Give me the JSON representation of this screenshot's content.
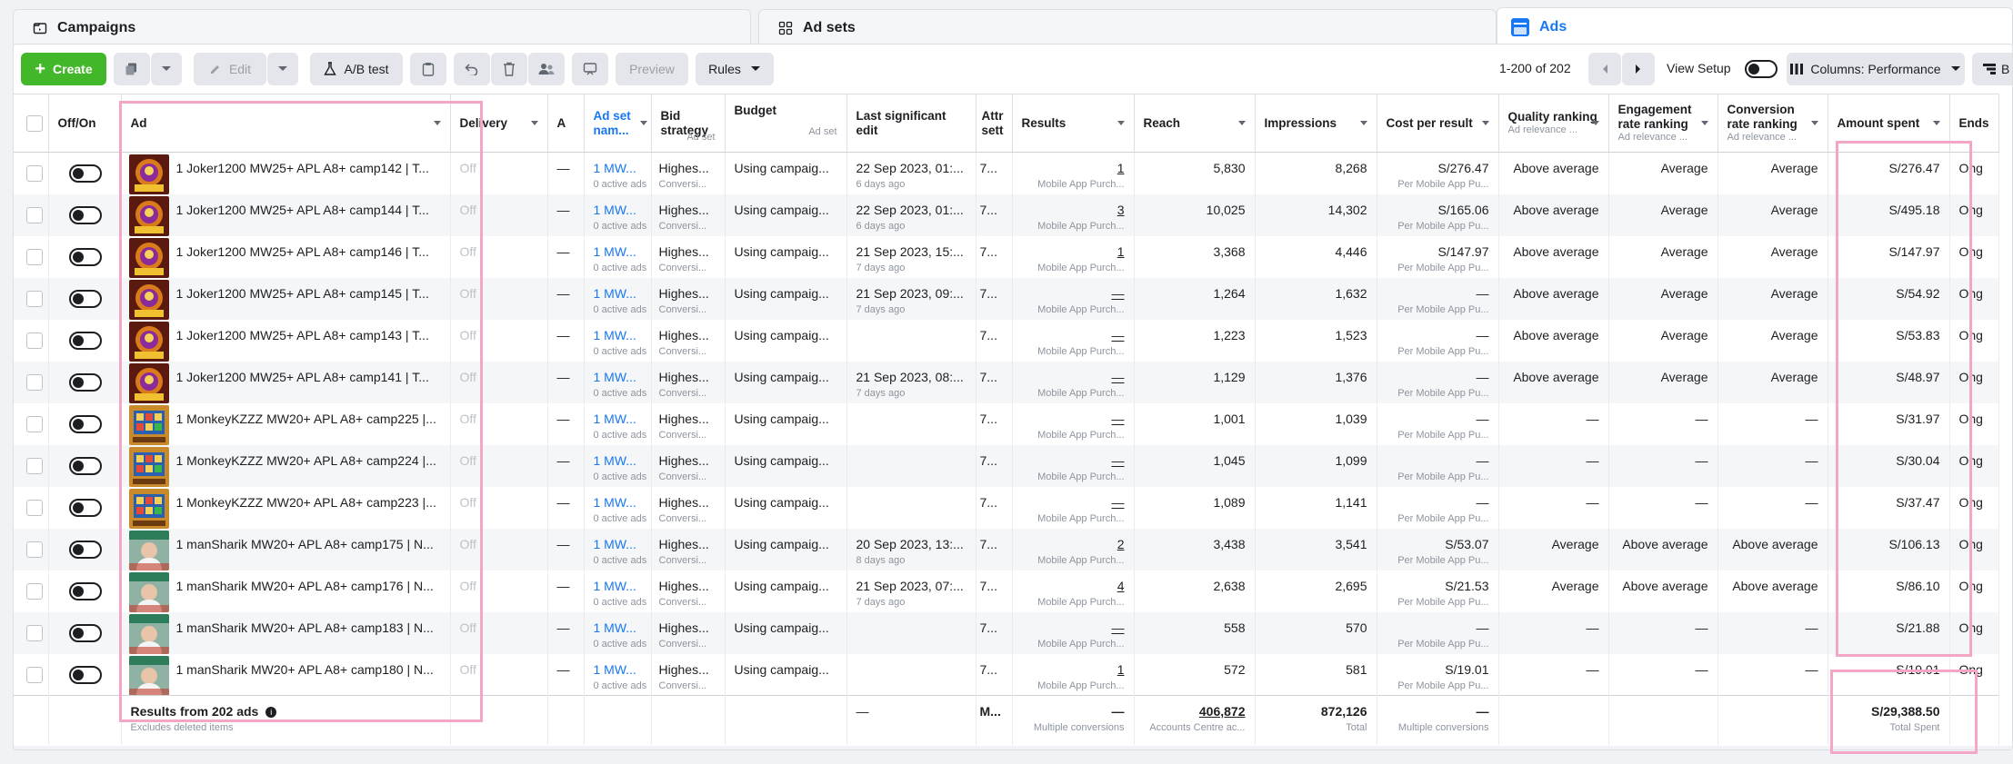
{
  "tabs": [
    {
      "label": "Campaigns",
      "icon": "folder-icon"
    },
    {
      "label": "Ad sets",
      "icon": "grid-icon"
    },
    {
      "label": "Ads",
      "icon": "ads-icon"
    }
  ],
  "toolbar": {
    "create_label": "Create",
    "edit_label": "Edit",
    "ab_test_label": "A/B test",
    "preview_label": "Preview",
    "rules_label": "Rules",
    "pagination": "1-200 of 202",
    "view_setup_label": "View Setup",
    "columns_label": "Columns: Performance",
    "breakdown_label": "B"
  },
  "columns": {
    "offon": "Off/On",
    "ad": "Ad",
    "delivery": "Delivery",
    "a": "A",
    "adset_name": "Ad set nam...",
    "bid_strategy": "Bid strategy",
    "bid_strategy_sub": "Ad set",
    "budget": "Budget",
    "budget_sub": "Ad set",
    "last_edit": "Last significant edit",
    "attr": "Attr sett",
    "results": "Results",
    "reach": "Reach",
    "impressions": "Impressions",
    "cpr": "Cost per result",
    "quality": "Quality ranking",
    "quality_sub": "Ad relevance ...",
    "engagement": "Engagement rate ranking",
    "engagement_sub": "Ad relevance ...",
    "conversion": "Conversion rate ranking",
    "conversion_sub": "Ad relevance ...",
    "amount": "Amount spent",
    "ends": "Ends"
  },
  "rows": [
    {
      "ad": "1 Joker1200 MW25+ APL A8+ camp142 | T...",
      "thumb": "joker",
      "delivery": "Off",
      "a": "—",
      "adset": "1 MW...",
      "adset_sub": "0 active ads",
      "bid": "Highes...",
      "bid_sub": "Conversi...",
      "budget": "Using campaig...",
      "edit": "22 Sep 2023, 01:...",
      "edit_sub": "6 days ago",
      "attr": "7...",
      "results": "1",
      "results_sub": "Mobile App Purch...",
      "reach": "5,830",
      "impr": "8,268",
      "cpr": "S/276.47",
      "cpr_sub": "Per Mobile App Pu...",
      "quality": "Above average",
      "engagement": "Average",
      "conversion": "Average",
      "amount": "S/276.47",
      "ends": "Ong"
    },
    {
      "ad": "1 Joker1200 MW25+ APL A8+ camp144 | T...",
      "thumb": "joker",
      "delivery": "Off",
      "a": "—",
      "adset": "1 MW...",
      "adset_sub": "0 active ads",
      "bid": "Highes...",
      "bid_sub": "Conversi...",
      "budget": "Using campaig...",
      "edit": "22 Sep 2023, 01:...",
      "edit_sub": "6 days ago",
      "attr": "7...",
      "results": "3",
      "results_sub": "Mobile App Purch...",
      "reach": "10,025",
      "impr": "14,302",
      "cpr": "S/165.06",
      "cpr_sub": "Per Mobile App Pu...",
      "quality": "Above average",
      "engagement": "Average",
      "conversion": "Average",
      "amount": "S/495.18",
      "ends": "Ong"
    },
    {
      "ad": "1 Joker1200 MW25+ APL A8+ camp146 | T...",
      "thumb": "joker",
      "delivery": "Off",
      "a": "—",
      "adset": "1 MW...",
      "adset_sub": "0 active ads",
      "bid": "Highes...",
      "bid_sub": "Conversi...",
      "budget": "Using campaig...",
      "edit": "21 Sep 2023, 15:...",
      "edit_sub": "7 days ago",
      "attr": "7...",
      "results": "1",
      "results_sub": "Mobile App Purch...",
      "reach": "3,368",
      "impr": "4,446",
      "cpr": "S/147.97",
      "cpr_sub": "Per Mobile App Pu...",
      "quality": "Above average",
      "engagement": "Average",
      "conversion": "Average",
      "amount": "S/147.97",
      "ends": "Ong"
    },
    {
      "ad": "1 Joker1200 MW25+ APL A8+ camp145 | T...",
      "thumb": "joker",
      "delivery": "Off",
      "a": "—",
      "adset": "1 MW...",
      "adset_sub": "0 active ads",
      "bid": "Highes...",
      "bid_sub": "Conversi...",
      "budget": "Using campaig...",
      "edit": "21 Sep 2023, 09:...",
      "edit_sub": "7 days ago",
      "attr": "7...",
      "results": "—",
      "results_sub": "Mobile App Purch...",
      "reach": "1,264",
      "impr": "1,632",
      "cpr": "—",
      "cpr_sub": "Per Mobile App Pu...",
      "quality": "Above average",
      "engagement": "Average",
      "conversion": "Average",
      "amount": "S/54.92",
      "ends": "Ong"
    },
    {
      "ad": "1 Joker1200 MW25+ APL A8+ camp143 | T...",
      "thumb": "joker",
      "delivery": "Off",
      "a": "—",
      "adset": "1 MW...",
      "adset_sub": "0 active ads",
      "bid": "Highes...",
      "bid_sub": "Conversi...",
      "budget": "Using campaig...",
      "edit": "",
      "edit_sub": "",
      "attr": "7...",
      "results": "—",
      "results_sub": "Mobile App Purch...",
      "reach": "1,223",
      "impr": "1,523",
      "cpr": "—",
      "cpr_sub": "Per Mobile App Pu...",
      "quality": "Above average",
      "engagement": "Average",
      "conversion": "Average",
      "amount": "S/53.83",
      "ends": "Ong"
    },
    {
      "ad": "1 Joker1200 MW25+ APL A8+ camp141 | T...",
      "thumb": "joker",
      "delivery": "Off",
      "a": "—",
      "adset": "1 MW...",
      "adset_sub": "0 active ads",
      "bid": "Highes...",
      "bid_sub": "Conversi...",
      "budget": "Using campaig...",
      "edit": "21 Sep 2023, 08:...",
      "edit_sub": "7 days ago",
      "attr": "7...",
      "results": "—",
      "results_sub": "Mobile App Purch...",
      "reach": "1,129",
      "impr": "1,376",
      "cpr": "—",
      "cpr_sub": "Per Mobile App Pu...",
      "quality": "Above average",
      "engagement": "Average",
      "conversion": "Average",
      "amount": "S/48.97",
      "ends": "Ong"
    },
    {
      "ad": "1 MonkeyKZZZ MW20+ APL A8+ camp225 |...",
      "thumb": "monkey",
      "delivery": "Off",
      "a": "—",
      "adset": "1 MW...",
      "adset_sub": "0 active ads",
      "bid": "Highes...",
      "bid_sub": "Conversi...",
      "budget": "Using campaig...",
      "edit": "",
      "edit_sub": "",
      "attr": "7...",
      "results": "—",
      "results_sub": "Mobile App Purch...",
      "reach": "1,001",
      "impr": "1,039",
      "cpr": "—",
      "cpr_sub": "Per Mobile App Pu...",
      "quality": "—",
      "engagement": "—",
      "conversion": "—",
      "amount": "S/31.97",
      "ends": "Ong"
    },
    {
      "ad": "1 MonkeyKZZZ MW20+ APL A8+ camp224 |...",
      "thumb": "monkey",
      "delivery": "Off",
      "a": "—",
      "adset": "1 MW...",
      "adset_sub": "0 active ads",
      "bid": "Highes...",
      "bid_sub": "Conversi...",
      "budget": "Using campaig...",
      "edit": "",
      "edit_sub": "",
      "attr": "7...",
      "results": "—",
      "results_sub": "Mobile App Purch...",
      "reach": "1,045",
      "impr": "1,099",
      "cpr": "—",
      "cpr_sub": "Per Mobile App Pu...",
      "quality": "—",
      "engagement": "—",
      "conversion": "—",
      "amount": "S/30.04",
      "ends": "Ong"
    },
    {
      "ad": "1 MonkeyKZZZ MW20+ APL A8+ camp223 |...",
      "thumb": "monkey",
      "delivery": "Off",
      "a": "—",
      "adset": "1 MW...",
      "adset_sub": "0 active ads",
      "bid": "Highes...",
      "bid_sub": "Conversi...",
      "budget": "Using campaig...",
      "edit": "",
      "edit_sub": "",
      "attr": "7...",
      "results": "—",
      "results_sub": "Mobile App Purch...",
      "reach": "1,089",
      "impr": "1,141",
      "cpr": "—",
      "cpr_sub": "Per Mobile App Pu...",
      "quality": "—",
      "engagement": "—",
      "conversion": "—",
      "amount": "S/37.47",
      "ends": "Ong"
    },
    {
      "ad": "1 manSharik MW20+ APL A8+ camp175 | N...",
      "thumb": "man",
      "delivery": "Off",
      "a": "—",
      "adset": "1 MW...",
      "adset_sub": "0 active ads",
      "bid": "Highes...",
      "bid_sub": "Conversi...",
      "budget": "Using campaig...",
      "edit": "20 Sep 2023, 13:...",
      "edit_sub": "8 days ago",
      "attr": "7...",
      "results": "2",
      "results_sub": "Mobile App Purch...",
      "reach": "3,438",
      "impr": "3,541",
      "cpr": "S/53.07",
      "cpr_sub": "Per Mobile App Pu...",
      "quality": "Average",
      "engagement": "Above average",
      "conversion": "Above average",
      "amount": "S/106.13",
      "ends": "Ong"
    },
    {
      "ad": "1 manSharik MW20+ APL A8+ camp176 | N...",
      "thumb": "man",
      "delivery": "Off",
      "a": "—",
      "adset": "1 MW...",
      "adset_sub": "0 active ads",
      "bid": "Highes...",
      "bid_sub": "Conversi...",
      "budget": "Using campaig...",
      "edit": "21 Sep 2023, 07:...",
      "edit_sub": "7 days ago",
      "attr": "7...",
      "results": "4",
      "results_sub": "Mobile App Purch...",
      "reach": "2,638",
      "impr": "2,695",
      "cpr": "S/21.53",
      "cpr_sub": "Per Mobile App Pu...",
      "quality": "Average",
      "engagement": "Above average",
      "conversion": "Above average",
      "amount": "S/86.10",
      "ends": "Ong"
    },
    {
      "ad": "1 manSharik MW20+ APL A8+ camp183 | N...",
      "thumb": "man",
      "delivery": "Off",
      "a": "—",
      "adset": "1 MW...",
      "adset_sub": "0 active ads",
      "bid": "Highes...",
      "bid_sub": "Conversi...",
      "budget": "Using campaig...",
      "edit": "",
      "edit_sub": "",
      "attr": "7...",
      "results": "—",
      "results_sub": "Mobile App Purch...",
      "reach": "558",
      "impr": "570",
      "cpr": "—",
      "cpr_sub": "Per Mobile App Pu...",
      "quality": "—",
      "engagement": "—",
      "conversion": "—",
      "amount": "S/21.88",
      "ends": "Ong"
    },
    {
      "ad": "1 manSharik MW20+ APL A8+ camp180 | N...",
      "thumb": "man",
      "delivery": "Off",
      "a": "—",
      "adset": "1 MW...",
      "adset_sub": "0 active ads",
      "bid": "Highes...",
      "bid_sub": "Conversi...",
      "budget": "Using campaig...",
      "edit": "",
      "edit_sub": "",
      "attr": "7...",
      "results": "1",
      "results_sub": "Mobile App Purch...",
      "reach": "572",
      "impr": "581",
      "cpr": "S/19.01",
      "cpr_sub": "Per Mobile App Pu...",
      "quality": "—",
      "engagement": "—",
      "conversion": "—",
      "amount": "S/19.01",
      "ends": "Ong"
    }
  ],
  "footer": {
    "label": "Results from 202 ads",
    "sub": "Excludes deleted items",
    "edit": "—",
    "attr": "M...",
    "results": "—",
    "results_sub": "Multiple conversions",
    "reach": "406,872",
    "reach_sub": "Accounts Centre ac...",
    "impr": "872,126",
    "impr_sub": "Total",
    "cpr": "—",
    "cpr_sub": "Multiple conversions",
    "amount": "S/29,388.50",
    "amount_sub": "Total Spent"
  },
  "colors": {
    "accent": "#1877f2",
    "create": "#42b72a",
    "highlight": "#f4a6c6"
  }
}
